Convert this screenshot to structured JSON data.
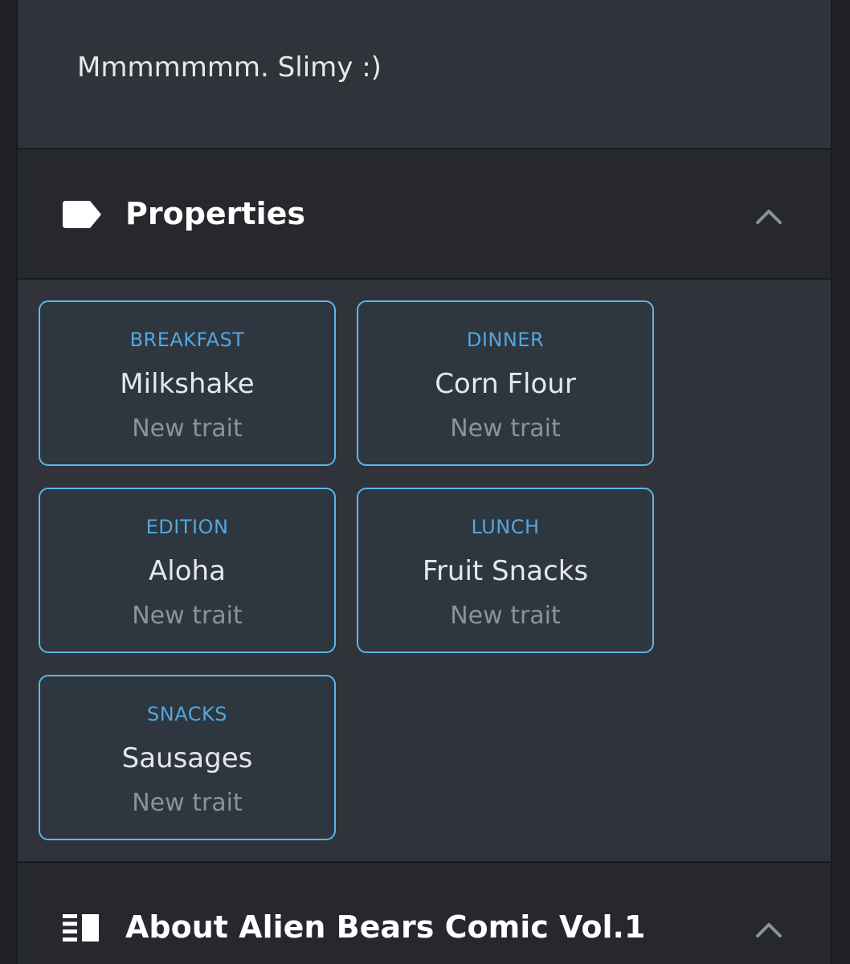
{
  "description": {
    "text": "Mmmmmmm. Slimy :)"
  },
  "properties": {
    "title": "Properties",
    "icon": "label-tag-icon",
    "toggle_icon": "chevron-up-icon",
    "traits": [
      {
        "type": "BREAKFAST",
        "value": "Milkshake",
        "rarity": "New trait"
      },
      {
        "type": "DINNER",
        "value": "Corn Flour",
        "rarity": "New trait"
      },
      {
        "type": "EDITION",
        "value": "Aloha",
        "rarity": "New trait"
      },
      {
        "type": "LUNCH",
        "value": "Fruit Snacks",
        "rarity": "New trait"
      },
      {
        "type": "SNACKS",
        "value": "Sausages",
        "rarity": "New trait"
      }
    ]
  },
  "about": {
    "title": "About Alien Bears Comic Vol.1",
    "icon": "subject-list-icon",
    "toggle_icon": "chevron-up-icon"
  },
  "colors": {
    "accent": "#59b7ea",
    "trait_type": "#53a7dc",
    "panel_bg": "#303339",
    "header_bg": "#26282d"
  }
}
